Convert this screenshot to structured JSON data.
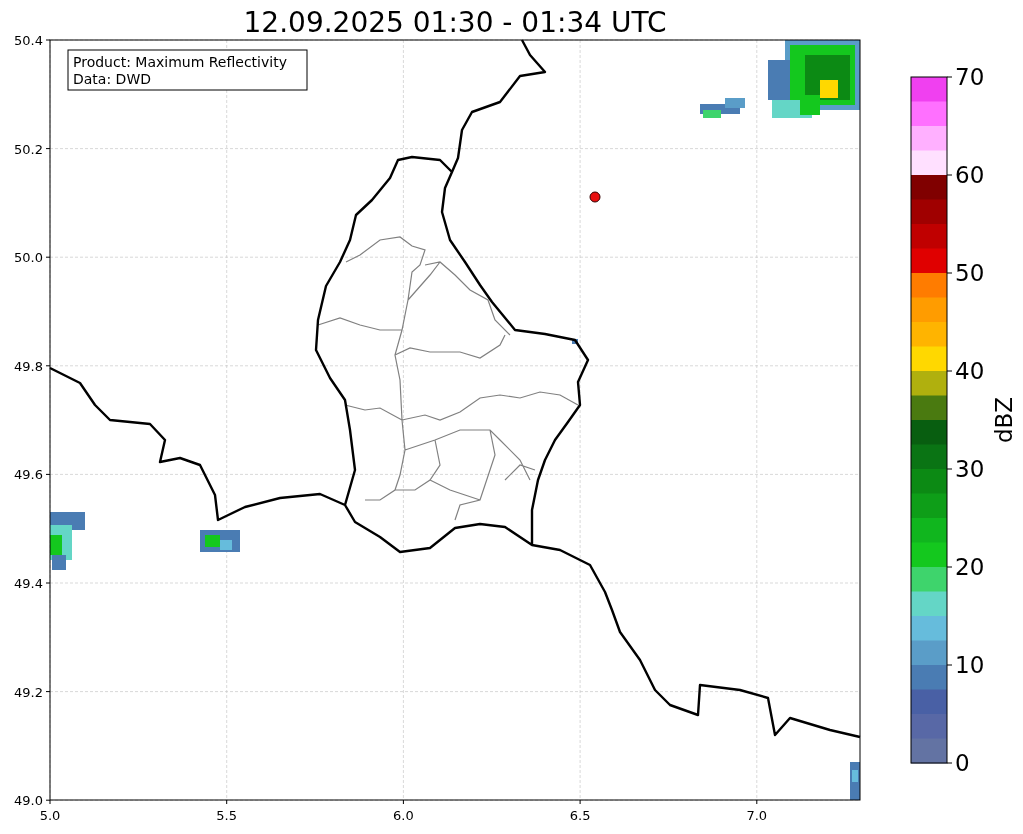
{
  "title": "12.09.2025 01:30 - 01:34 UTC",
  "info_box": [
    "Product: Maximum Reflectivity",
    "Data: DWD"
  ],
  "x_ticks": [
    "5.0",
    "5.5",
    "6.0",
    "6.5",
    "7.0"
  ],
  "y_ticks": [
    "50.4",
    "50.2",
    "50.0",
    "49.8",
    "49.6",
    "49.4",
    "49.2",
    "49.0"
  ],
  "colorbar": {
    "label": "dBZ",
    "ticks": [
      "70",
      "60",
      "50",
      "40",
      "30",
      "20",
      "10",
      "0"
    ],
    "segments": [
      {
        "color": "#f040f0"
      },
      {
        "color": "#ff70ff"
      },
      {
        "color": "#ffb0ff"
      },
      {
        "color": "#ffe0ff"
      },
      {
        "color": "#800000"
      },
      {
        "color": "#a00000"
      },
      {
        "color": "#c00000"
      },
      {
        "color": "#e00000"
      },
      {
        "color": "#ff7c00"
      },
      {
        "color": "#ff9c00"
      },
      {
        "color": "#ffb400"
      },
      {
        "color": "#ffd800"
      },
      {
        "color": "#b0b00e"
      },
      {
        "color": "#4a7a10"
      },
      {
        "color": "#085e10"
      },
      {
        "color": "#0a7414"
      },
      {
        "color": "#0c8a14"
      },
      {
        "color": "#0e9e18"
      },
      {
        "color": "#10b61e"
      },
      {
        "color": "#14c81e"
      },
      {
        "color": "#3ed46c"
      },
      {
        "color": "#64d6c6"
      },
      {
        "color": "#66bcdc"
      },
      {
        "color": "#5a9dc8"
      },
      {
        "color": "#4a7cb3"
      },
      {
        "color": "#4960a5"
      },
      {
        "color": "#5868a6"
      },
      {
        "color": "#6373a3"
      }
    ]
  }
}
